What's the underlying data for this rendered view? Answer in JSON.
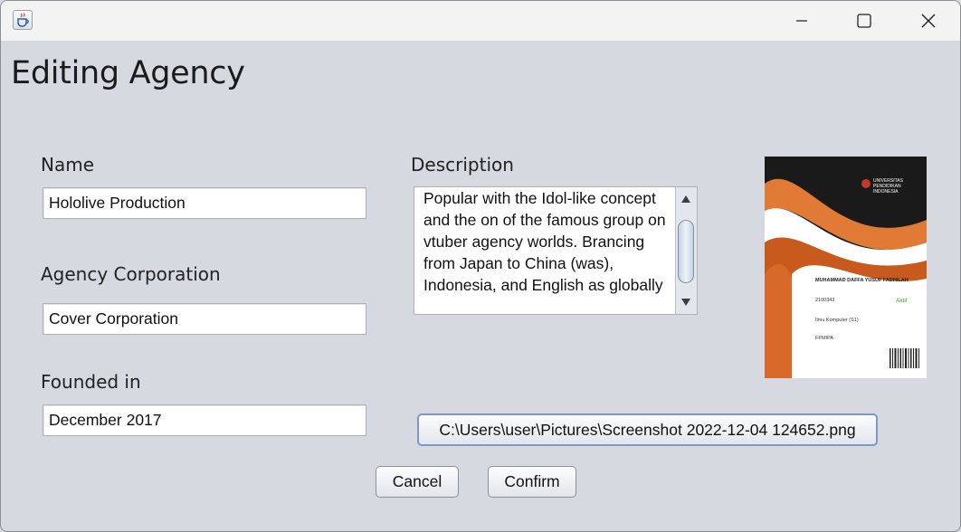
{
  "window": {
    "icons": {
      "app": "java-cup-icon",
      "minimize": "minimize-icon",
      "maximize": "maximize-icon",
      "close": "close-icon"
    }
  },
  "heading": "Editing Agency",
  "form": {
    "name_label": "Name",
    "name_value": "Hololive Production",
    "corporation_label": "Agency Corporation",
    "corporation_value": "Cover Corporation",
    "founded_label": "Founded in",
    "founded_value": "December 2017",
    "description_label": "Description",
    "description_value": "Popular with the Idol-like concept and the on of the famous group on vtuber agency worlds. Brancing from Japan to China (was), Indonesia, and English as globally"
  },
  "preview": {
    "logo_text": "UNIVERSITAS PENDIDIKAN INDONESIA",
    "card_name": "MUHAMMAD DAFFA YUSUF FADHILAH",
    "card_id": "2100343",
    "card_status": "Aktif",
    "card_program": "Ilmu Komputer (S1)",
    "card_faculty": "FPMIPA"
  },
  "file_path": "C:\\Users\\user\\Pictures\\Screenshot 2022-12-04 124652.png",
  "buttons": {
    "cancel": "Cancel",
    "confirm": "Confirm"
  },
  "colors": {
    "background": "#d6d9e0",
    "card_orange": "#d9692a",
    "card_dark": "#1a1a1a",
    "status_green": "#3aa63a"
  }
}
